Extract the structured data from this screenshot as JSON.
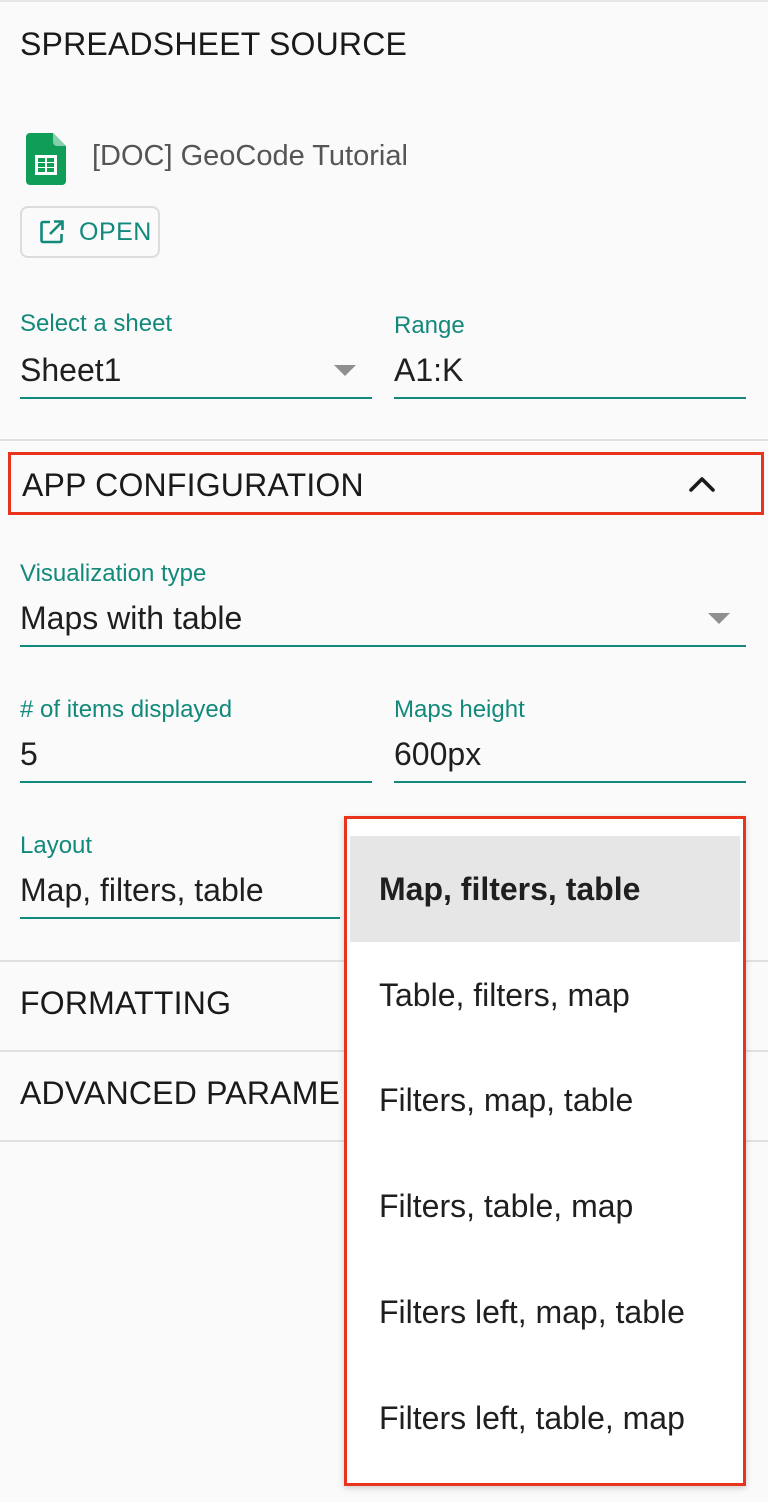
{
  "spreadsheet_source": {
    "title": "SPREADSHEET SOURCE",
    "doc_icon": "google-sheets-icon",
    "doc_name": "[DOC] GeoCode Tutorial",
    "open_button": {
      "icon": "open-in-new-icon",
      "label": "OPEN"
    },
    "sheet_select": {
      "label": "Select a sheet",
      "value": "Sheet1"
    },
    "range_field": {
      "label": "Range",
      "value": "A1:K"
    }
  },
  "app_configuration": {
    "title": "APP CONFIGURATION",
    "toggle_icon": "chevron-up-icon",
    "visualization_type": {
      "label": "Visualization type",
      "value": "Maps with table"
    },
    "items_displayed": {
      "label": "# of items displayed",
      "value": "5"
    },
    "maps_height": {
      "label": "Maps height",
      "value": "600px"
    },
    "layout": {
      "label": "Layout",
      "value": "Map, filters, table",
      "options": [
        "Map, filters, table",
        "Table, filters, map",
        "Filters, map, table",
        "Filters, table, map",
        "Filters left, map, table",
        "Filters left, table, map"
      ],
      "selected_index": 0
    }
  },
  "formatting": {
    "title": "FORMATTING"
  },
  "advanced_parameters": {
    "title": "ADVANCED PARAME"
  },
  "colors": {
    "accent": "#12897b",
    "highlight": "#e8341c",
    "sheets_green": "#0f9d58"
  }
}
